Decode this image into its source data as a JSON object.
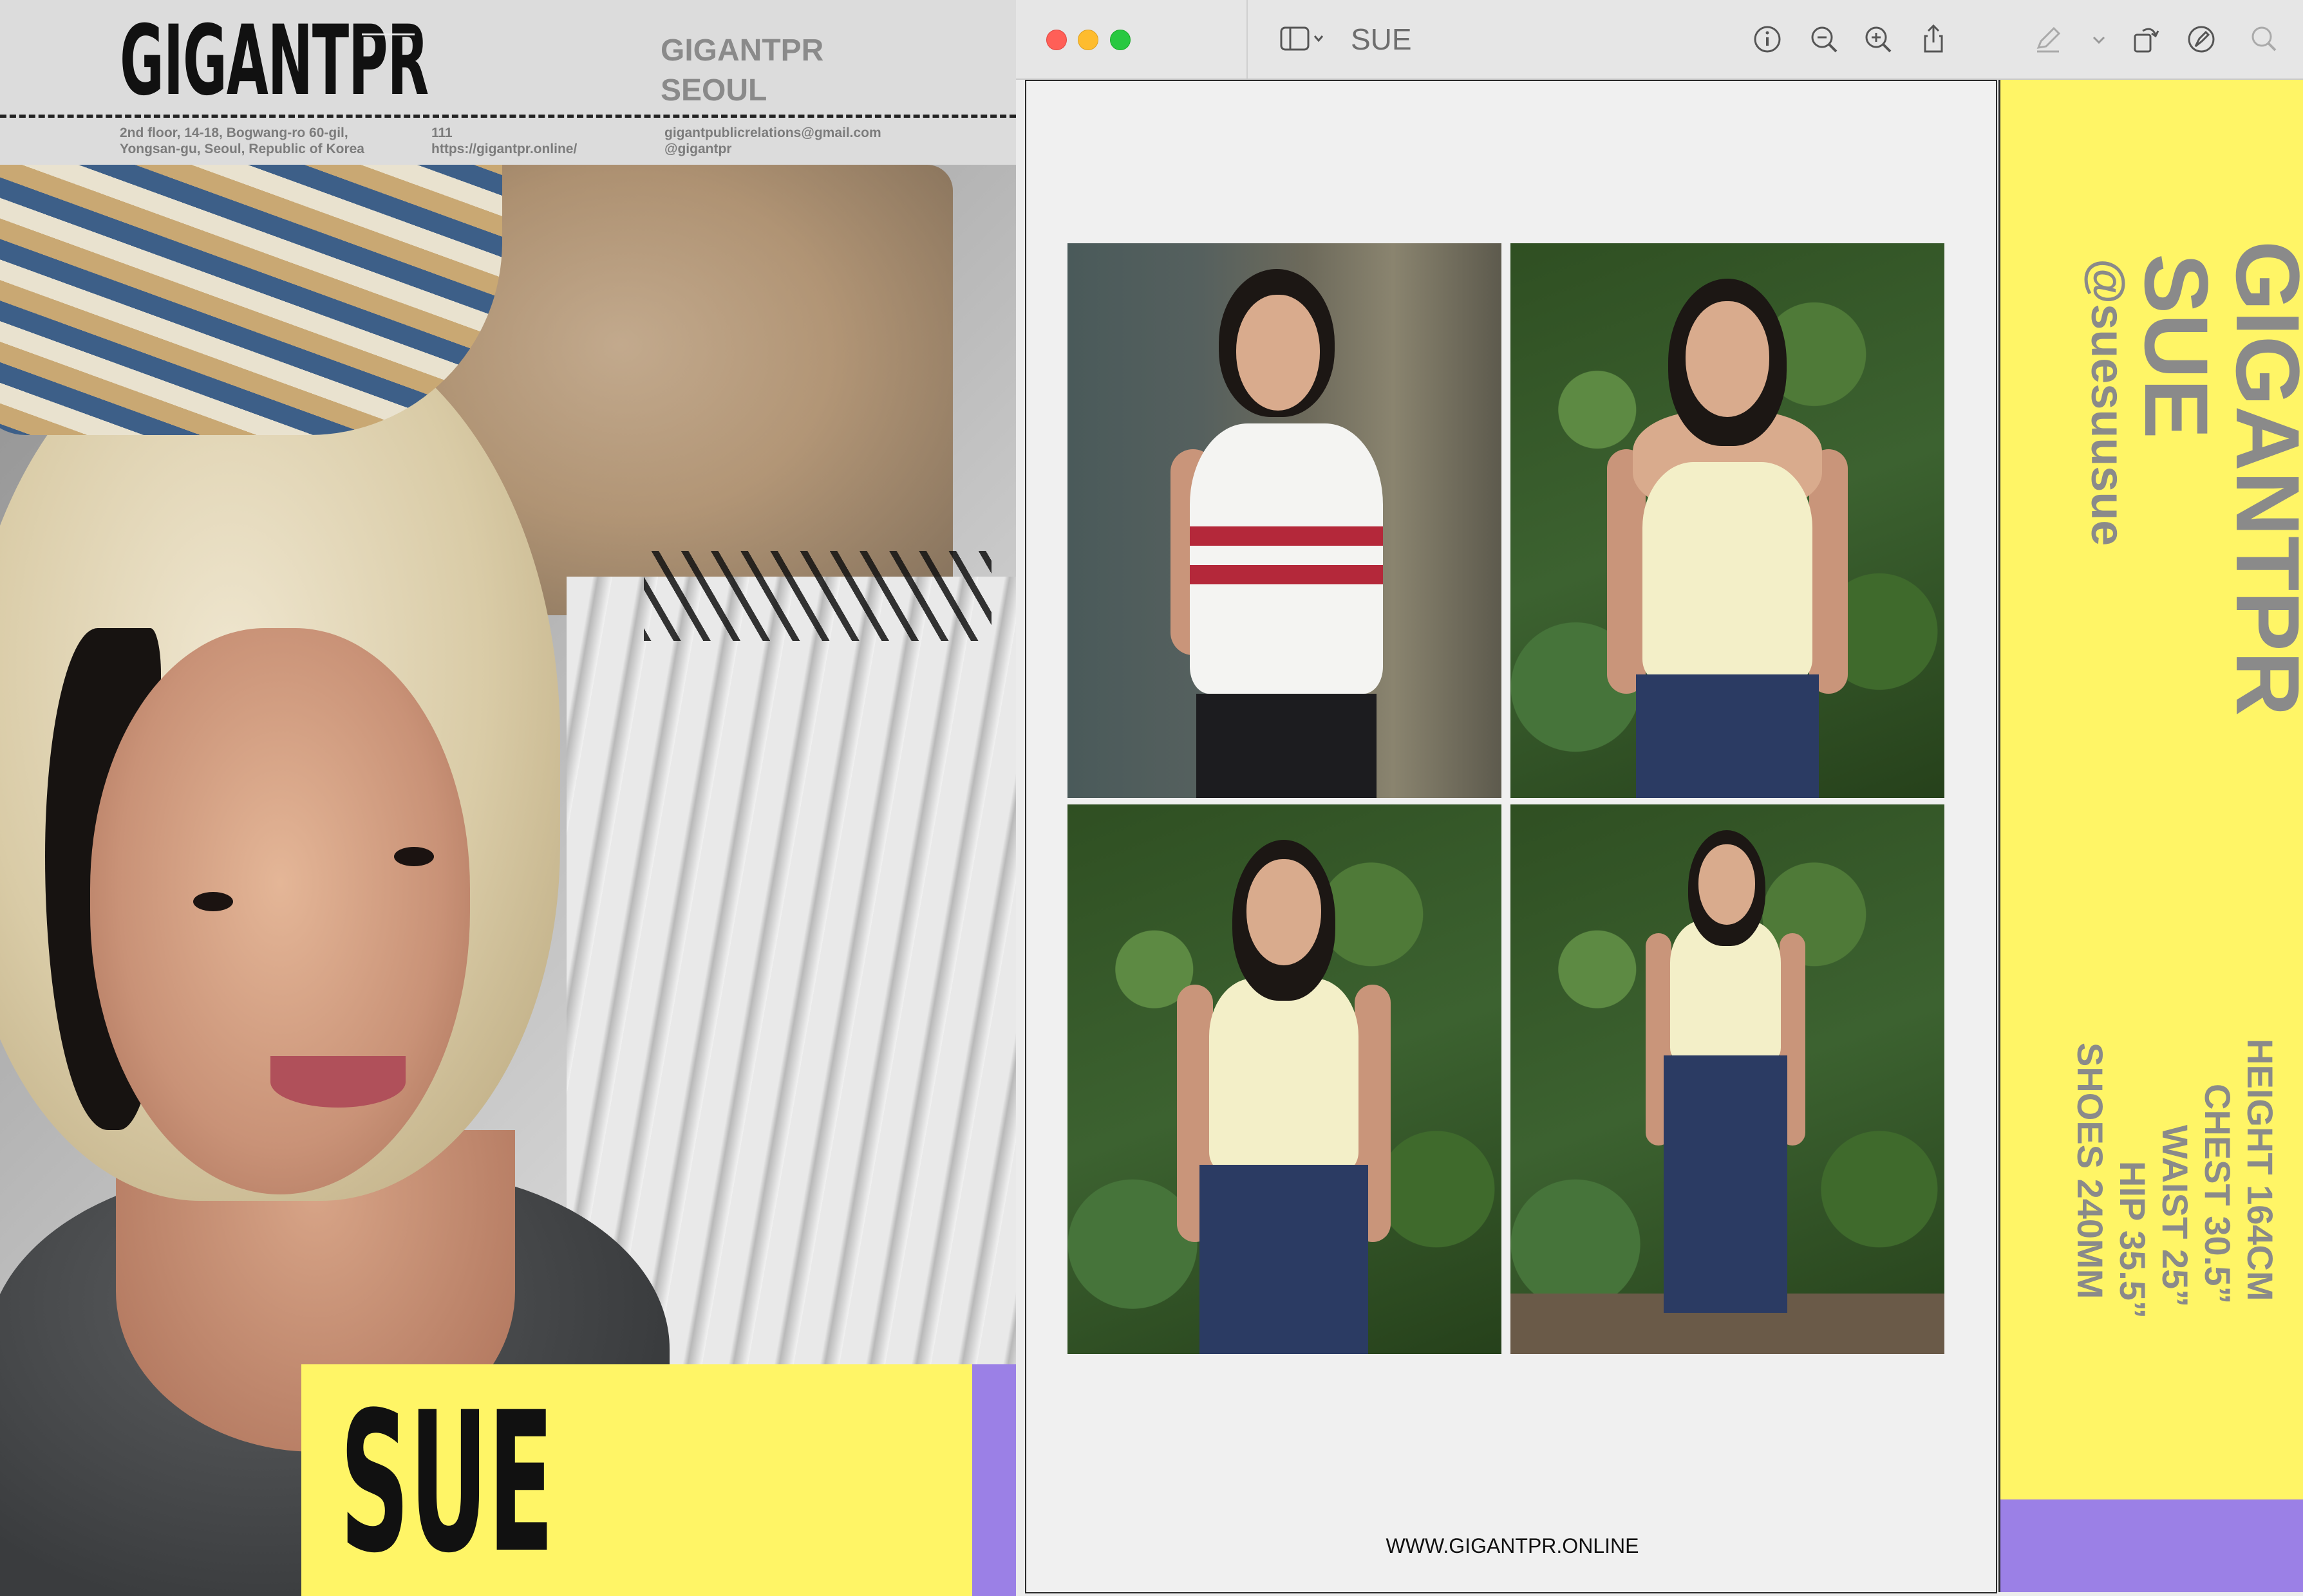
{
  "left_card": {
    "logo": "GIGANTPR",
    "agency_name_line1": "GIGANTPR",
    "agency_name_line2": "SEOUL",
    "address_line1": "2nd floor, 14-18, Bogwang-ro 60-gil,",
    "address_line2": "Yongsan-gu, Seoul, Republic of Korea",
    "number_line1": "111",
    "number_line2": "https://gigantpr.online/",
    "email_line1": "gigantpublicrelations@gmail.com",
    "email_line2": "@gigantpr",
    "model_name": "SUE"
  },
  "window": {
    "title": "SUE",
    "toolbar_icons": [
      "sidebar-icon",
      "info-icon",
      "zoom-out-icon",
      "zoom-in-icon",
      "share-icon",
      "markup-pen-icon",
      "chevron-down-icon",
      "rotate-icon",
      "markup-icon",
      "search-icon"
    ],
    "footer_url": "WWW.GIGANTPR.ONLINE"
  },
  "info_strip": {
    "agency": "GIGANTPR",
    "name": "SUE",
    "handle": "@suesuusue",
    "stats": {
      "height": "HEIGHT 164CM",
      "chest": "CHEST 30.5”",
      "waist": "WAIST 25”",
      "hip": "HIP 35.5”",
      "shoes": "SHOES 240MM"
    }
  },
  "colors": {
    "accent_yellow": "#fff566",
    "accent_purple": "#9b80e6",
    "traffic_close": "#ff5f57",
    "traffic_min": "#febc2e",
    "traffic_max": "#28c840"
  }
}
